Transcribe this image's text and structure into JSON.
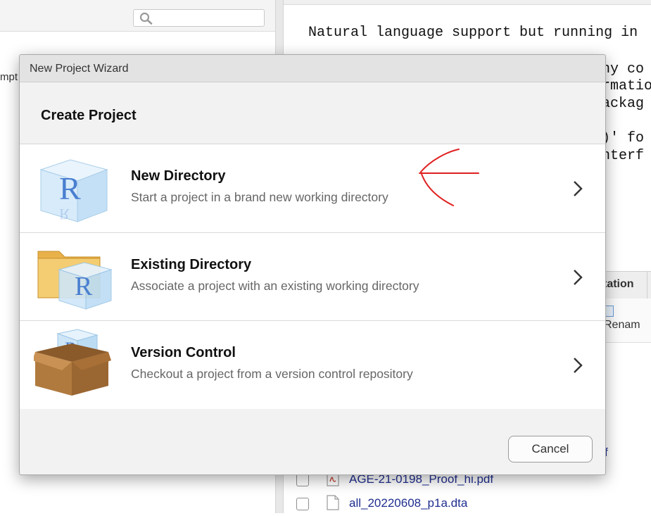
{
  "background": {
    "left_pane": {
      "search_placeholder": "",
      "clipped_text": "mpt"
    },
    "console": {
      "lines": [
        "Natural language support but running in",
        "ny co",
        "rmatio",
        "ackag",
        ")' fo",
        "nterf"
      ]
    },
    "files_pane": {
      "tab_label": "tation",
      "rename_label": "Renam",
      "clipped_link": "f",
      "files": [
        {
          "name": "AGE-21-0198_Proof_hi.pdf",
          "icon": "pdf-file-icon"
        },
        {
          "name": "all_20220608_p1a.dta",
          "icon": "file-icon"
        }
      ]
    }
  },
  "dialog": {
    "title": "New Project Wizard",
    "heading": "Create Project",
    "options": [
      {
        "title": "New Directory",
        "description": "Start a project in a brand new working directory",
        "icon": "r-cube-icon"
      },
      {
        "title": "Existing Directory",
        "description": "Associate a project with an existing working directory",
        "icon": "folder-r-icon"
      },
      {
        "title": "Version Control",
        "description": "Checkout a project from a version control repository",
        "icon": "box-r-icon"
      }
    ],
    "cancel_label": "Cancel"
  },
  "colors": {
    "annotation": "#e02020",
    "link": "#1f2e8f",
    "r_blue": "#4a7fd0"
  }
}
